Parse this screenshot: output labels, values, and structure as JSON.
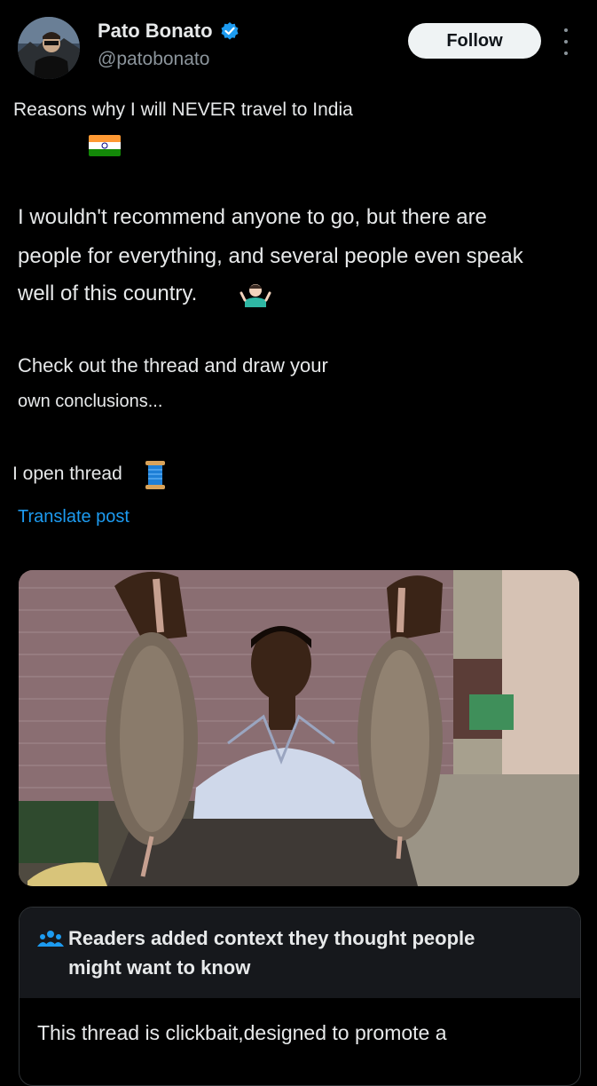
{
  "author": {
    "name": "Pato Bonato",
    "handle": "@patobonato",
    "verified_color": "#1d9bf0"
  },
  "actions": {
    "follow_label": "Follow",
    "more_icon": "more-vertical-icon"
  },
  "post": {
    "line1": "Reasons why I will NEVER travel to India",
    "flag_icon": "india-flag-icon",
    "line2": "I wouldn't recommend anyone to go, but there are",
    "line3": "people for everything, and several people even speak",
    "line4": "well of this country.",
    "shrug_icon": "person-shrugging-icon",
    "line5": "Check out the thread and draw your",
    "line6": "own conclusions...",
    "line7": "I open thread",
    "spool_icon": "thread-spool-icon",
    "translate_label": "Translate post"
  },
  "media": {
    "alt_icon": "photo-man-holding-rats"
  },
  "community_note": {
    "icon": "people-icon",
    "title_line1": "Readers added context they thought people",
    "title_line2": "might want to know",
    "body_line1": "This thread is clickbait,designed to promote a"
  },
  "colors": {
    "background": "#000000",
    "text": "#e7e9ea",
    "secondary": "#8b949b",
    "link": "#1d9bf0",
    "note_header": "#16181c"
  }
}
